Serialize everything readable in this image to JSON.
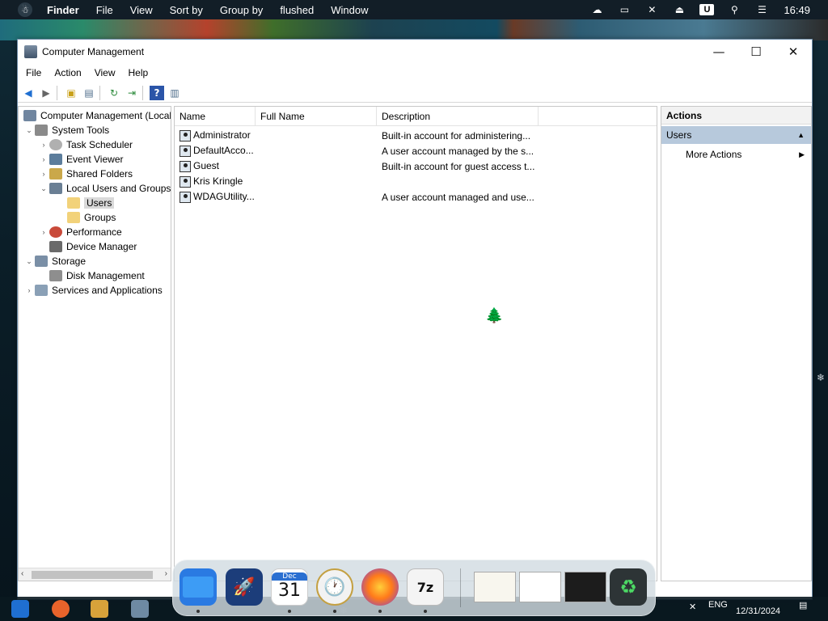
{
  "menubar": {
    "app_name": "Finder",
    "items": [
      "File",
      "View",
      "Sort by",
      "Group by",
      "flushed",
      "Window"
    ],
    "user_badge": "U",
    "clock": "16:49"
  },
  "window": {
    "title": "Computer Management",
    "menu": [
      "File",
      "Action",
      "View",
      "Help"
    ]
  },
  "tree": {
    "items": [
      {
        "label": "Computer Management (Local",
        "icon": "computer-management-icon",
        "arrow": ""
      },
      {
        "label": "System Tools",
        "icon": "tools-icon",
        "arrow": "expanded"
      },
      {
        "label": "Task Scheduler",
        "icon": "clock-icon",
        "arrow": "collapsed"
      },
      {
        "label": "Event Viewer",
        "icon": "event-viewer-icon",
        "arrow": "collapsed"
      },
      {
        "label": "Shared Folders",
        "icon": "shared-folder-icon",
        "arrow": "collapsed"
      },
      {
        "label": "Local Users and Groups",
        "icon": "users-groups-icon",
        "arrow": "expanded"
      },
      {
        "label": "Users",
        "icon": "folder-icon",
        "arrow": ""
      },
      {
        "label": "Groups",
        "icon": "folder-icon",
        "arrow": ""
      },
      {
        "label": "Performance",
        "icon": "performance-icon",
        "arrow": "collapsed"
      },
      {
        "label": "Device Manager",
        "icon": "device-manager-icon",
        "arrow": ""
      },
      {
        "label": "Storage",
        "icon": "storage-icon",
        "arrow": "expanded"
      },
      {
        "label": "Disk Management",
        "icon": "disk-icon",
        "arrow": ""
      },
      {
        "label": "Services and Applications",
        "icon": "services-icon",
        "arrow": "collapsed"
      }
    ]
  },
  "list": {
    "columns": [
      "Name",
      "Full Name",
      "Description"
    ],
    "rows": [
      {
        "name": "Administrator",
        "full_name": "",
        "description": "Built-in account for administering..."
      },
      {
        "name": "DefaultAcco...",
        "full_name": "",
        "description": "A user account managed by the s..."
      },
      {
        "name": "Guest",
        "full_name": "",
        "description": "Built-in account for guest access t..."
      },
      {
        "name": "Kris Kringle",
        "full_name": "",
        "description": ""
      },
      {
        "name": "WDAGUtility...",
        "full_name": "",
        "description": "A user account managed and use..."
      }
    ]
  },
  "actions": {
    "header": "Actions",
    "section": "Users",
    "more": "More Actions"
  },
  "dock": {
    "calendar_month": "Dec",
    "calendar_day": "31"
  },
  "tray": {
    "language": "ENG",
    "date": "12/31/2024"
  },
  "colors": {
    "selection": "#b7c9dc",
    "accent": "#1f6fd1"
  }
}
